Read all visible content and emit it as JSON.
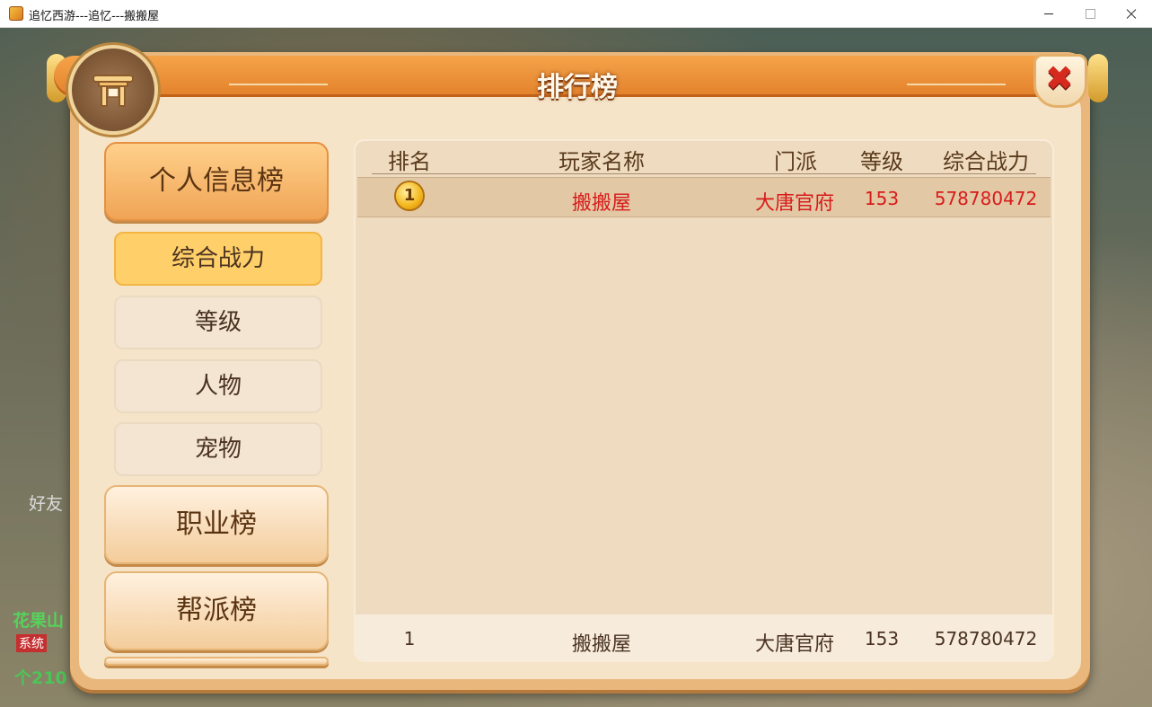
{
  "window": {
    "title": "追忆西游---追忆---搬搬屋"
  },
  "background": {
    "friend_label": "好友",
    "chat_location": "花果山",
    "system_tag": "系统",
    "bottom_number": "个210"
  },
  "panel": {
    "title": "排行榜",
    "close_icon": "close-icon"
  },
  "sidebar": {
    "categories": [
      {
        "label": "个人信息榜",
        "active": true
      },
      {
        "label": "职业榜",
        "active": false
      },
      {
        "label": "帮派榜",
        "active": false
      }
    ],
    "subitems": [
      {
        "label": "综合战力",
        "active": true
      },
      {
        "label": "等级",
        "active": false
      },
      {
        "label": "人物",
        "active": false
      },
      {
        "label": "宠物",
        "active": false
      }
    ]
  },
  "table": {
    "headers": [
      "排名",
      "玩家名称",
      "门派",
      "等级",
      "综合战力"
    ],
    "rows": [
      {
        "rank": "1",
        "name": "搬搬屋",
        "faction": "大唐官府",
        "level": "153",
        "power": "578780472"
      }
    ],
    "footer": {
      "rank": "1",
      "name": "搬搬屋",
      "faction": "大唐官府",
      "level": "153",
      "power": "578780472"
    }
  },
  "colors": {
    "accent": "#f0a455",
    "highlight_text": "#d81b1b",
    "selected_sub": "#ffd06a"
  }
}
